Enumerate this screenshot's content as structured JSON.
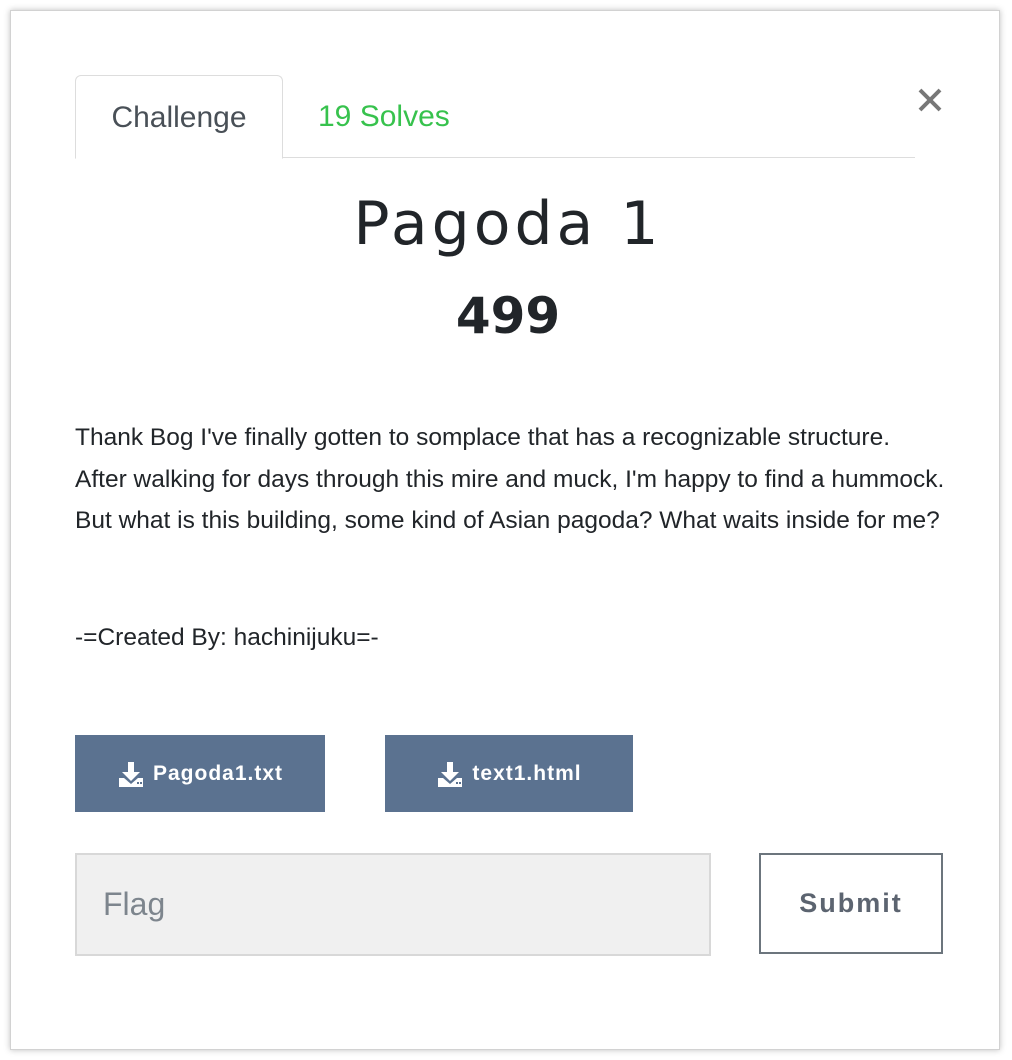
{
  "tabs": {
    "challenge_label": "Challenge",
    "solves_label": "19 Solves"
  },
  "challenge": {
    "name": "Pagoda 1",
    "points": "499",
    "description": "Thank Bog I've finally gotten to somplace that has a recognizable structure. After walking for days through this mire and muck, I'm happy to find a hummock. But what is this building, some kind of Asian pagoda? What waits inside for me?",
    "author": "-=Created By: hachinijuku=-"
  },
  "files": [
    {
      "label": "Pagoda1.txt",
      "icon": "download-icon"
    },
    {
      "label": "text1.html",
      "icon": "download-icon"
    }
  ],
  "flag_form": {
    "placeholder": "Flag",
    "value": "",
    "submit_label": "Submit"
  },
  "close": {
    "icon": "close-icon"
  },
  "colors": {
    "accent_green": "#37c24d",
    "file_button": "#5b7290",
    "input_bg": "#f0f0f0"
  }
}
